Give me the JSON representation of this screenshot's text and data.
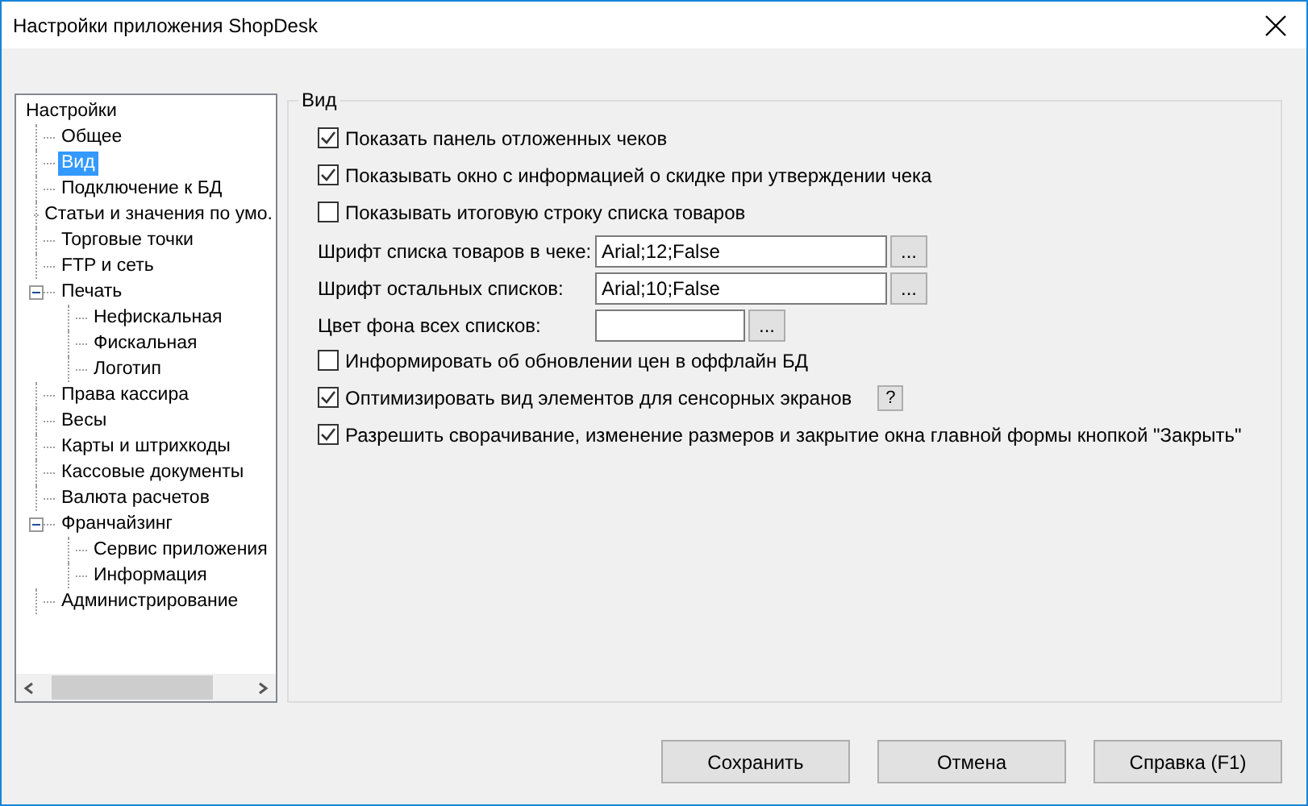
{
  "window": {
    "title": "Настройки приложения ShopDesk"
  },
  "tree": {
    "items": [
      {
        "label": "Настройки",
        "selected": false,
        "children": [
          {
            "label": "Общее",
            "selected": false
          },
          {
            "label": "Вид",
            "selected": true
          },
          {
            "label": "Подключение к БД",
            "selected": false
          },
          {
            "label": "Статьи и значения по умо.",
            "selected": false
          },
          {
            "label": "Торговые точки",
            "selected": false
          },
          {
            "label": "FTP и сеть",
            "selected": false
          },
          {
            "label": "Печать",
            "selected": false,
            "expanded": true,
            "children": [
              {
                "label": "Нефискальная",
                "selected": false
              },
              {
                "label": "Фискальная",
                "selected": false
              },
              {
                "label": "Логотип",
                "selected": false
              }
            ]
          },
          {
            "label": "Права кассира",
            "selected": false
          },
          {
            "label": "Весы",
            "selected": false
          },
          {
            "label": "Карты и штрихкоды",
            "selected": false
          },
          {
            "label": "Кассовые документы",
            "selected": false
          },
          {
            "label": "Валюта расчетов",
            "selected": false
          },
          {
            "label": "Франчайзинг",
            "selected": false,
            "expanded": true,
            "children": [
              {
                "label": "Сервис приложения",
                "selected": false
              },
              {
                "label": "Информация",
                "selected": false
              }
            ]
          },
          {
            "label": "Администрирование",
            "selected": false
          }
        ]
      }
    ]
  },
  "group": {
    "title": "Вид",
    "rows": [
      {
        "kind": "checkbox",
        "label": "Показать панель отложенных чеков",
        "checked": true
      },
      {
        "kind": "checkbox",
        "label": "Показывать окно с информацией о скидке при утверждении чека",
        "checked": true
      },
      {
        "kind": "checkbox",
        "label": "Показывать итоговую строку списка товаров",
        "checked": false
      },
      {
        "kind": "font",
        "label": "Шрифт списка товаров в чеке:",
        "value": "Arial;12;False",
        "button": "..."
      },
      {
        "kind": "font",
        "label": "Шрифт остальных списков:",
        "value": "Arial;10;False",
        "button": "..."
      },
      {
        "kind": "color",
        "label": "Цвет фона всех списков:",
        "button": "..."
      },
      {
        "kind": "checkbox",
        "label": "Информировать об обновлении цен в оффлайн БД",
        "checked": false
      },
      {
        "kind": "checkbox",
        "label": "Оптимизировать вид элементов для сенсорных экранов",
        "checked": true,
        "help": "?"
      },
      {
        "kind": "checkbox",
        "label": "Разрешить сворачивание, изменение размеров и закрытие окна главной формы кнопкой \"Закрыть\"",
        "checked": true
      }
    ]
  },
  "buttons": [
    "Сохранить",
    "Отмена",
    "Справка (F1)"
  ]
}
